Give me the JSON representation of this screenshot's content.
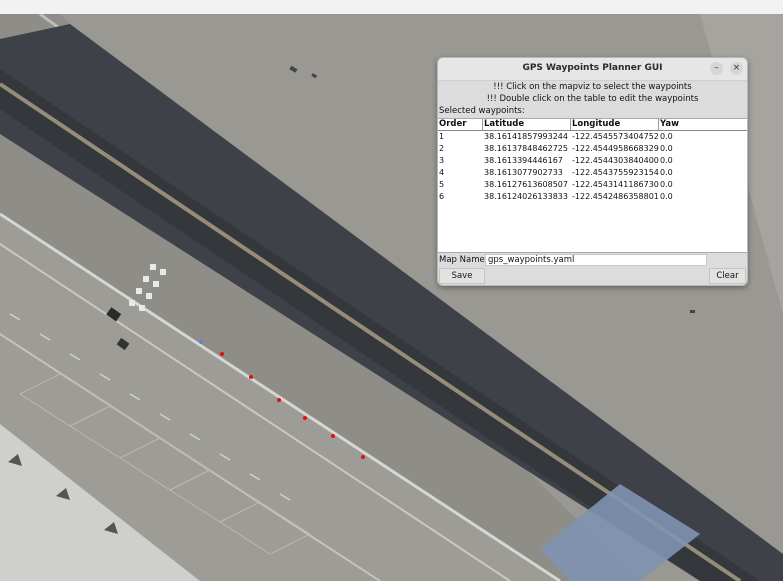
{
  "window": {
    "title": "GPS Waypoints Planner GUI",
    "minimize_symbol": "–",
    "close_symbol": "×",
    "instruction_1": "!!! Click on the mapviz to select the waypoints",
    "instruction_2": "!!! Double click on the table to edit the waypoints",
    "selected_label": "Selected waypoints:",
    "table": {
      "columns": [
        "Order",
        "Latitude",
        "Longitude",
        "Yaw"
      ],
      "rows": [
        [
          "1",
          "38.16141857993244",
          "-122.4545573404752",
          "0.0"
        ],
        [
          "2",
          "38.16137848462725",
          "-122.4544958668329",
          "0.0"
        ],
        [
          "3",
          "38.1613394446167",
          "-122.4544303840400",
          "0.0"
        ],
        [
          "4",
          "38.1613077902733",
          "-122.4543755923154",
          "0.0"
        ],
        [
          "5",
          "38.16127613608507",
          "-122.4543141186730",
          "0.0"
        ],
        [
          "6",
          "38.16124026133833",
          "-122.4542486358801",
          "0.0"
        ]
      ]
    },
    "map_name_label": "Map Name:",
    "map_name_value": "gps_waypoints.yaml",
    "save_label": "Save",
    "clear_label": "Clear"
  },
  "map": {
    "waypoint_color": "#e11010",
    "selected_point_color": "#5a86d8"
  }
}
